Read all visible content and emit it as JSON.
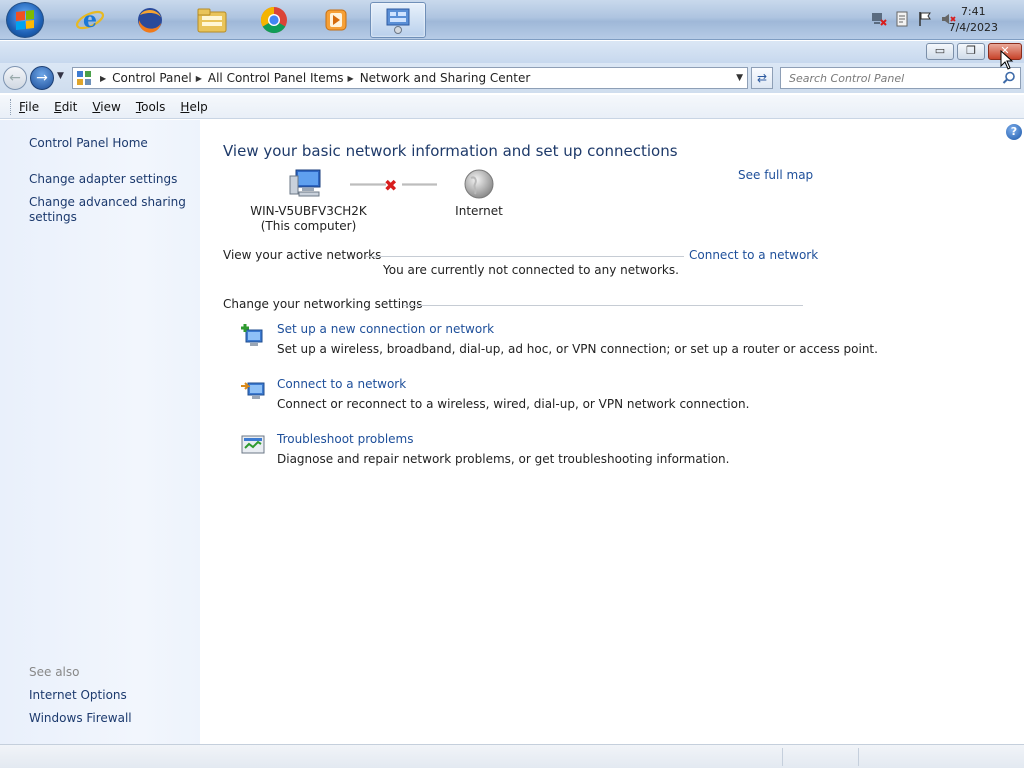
{
  "taskbar": {
    "apps": [
      {
        "name": "internet-explorer"
      },
      {
        "name": "firefox"
      },
      {
        "name": "file-explorer"
      },
      {
        "name": "chrome"
      },
      {
        "name": "media-player"
      },
      {
        "name": "control-panel"
      }
    ],
    "clock": {
      "time": "7:41",
      "date": "7/4/2023"
    }
  },
  "window": {
    "caption_buttons": {
      "minimize": "▭",
      "restore": "❐",
      "close": "✕"
    }
  },
  "address": {
    "crumbs": [
      "Control Panel",
      "All Control Panel Items",
      "Network and Sharing Center"
    ],
    "search_placeholder": "Search Control Panel"
  },
  "menu": {
    "items": [
      {
        "first": "F",
        "rest": "ile"
      },
      {
        "first": "E",
        "rest": "dit"
      },
      {
        "first": "V",
        "rest": "iew"
      },
      {
        "first": "T",
        "rest": "ools"
      },
      {
        "first": "H",
        "rest": "elp"
      }
    ]
  },
  "sidebar": {
    "home": "Control Panel Home",
    "adapter": "Change adapter settings",
    "advanced_line1": "Change advanced sharing",
    "advanced_line2": "settings",
    "see_also": "See also",
    "internet_options": "Internet Options",
    "firewall": "Windows Firewall"
  },
  "main": {
    "title": "View your basic network information and set up connections",
    "see_full_map": "See full map",
    "computer_name": "WIN-V5UBFV3CH2K",
    "computer_sub": "(This computer)",
    "internet": "Internet",
    "active_networks_head": "View your active networks",
    "connect_link": "Connect to a network",
    "not_connected": "You are currently not connected to any networks.",
    "change_settings_head": "Change your networking settings",
    "tasks": [
      {
        "title": "Set up a new connection or network",
        "desc": "Set up a wireless, broadband, dial-up, ad hoc, or VPN connection; or set up a router or access point."
      },
      {
        "title": "Connect to a network",
        "desc": "Connect or reconnect to a wireless, wired, dial-up, or VPN network connection."
      },
      {
        "title": "Troubleshoot problems",
        "desc": "Diagnose and repair network problems, or get troubleshooting information."
      }
    ],
    "help": "?"
  },
  "colors": {
    "link": "#1e4f9a",
    "title": "#1e3a6a",
    "error": "#d81d1d"
  }
}
